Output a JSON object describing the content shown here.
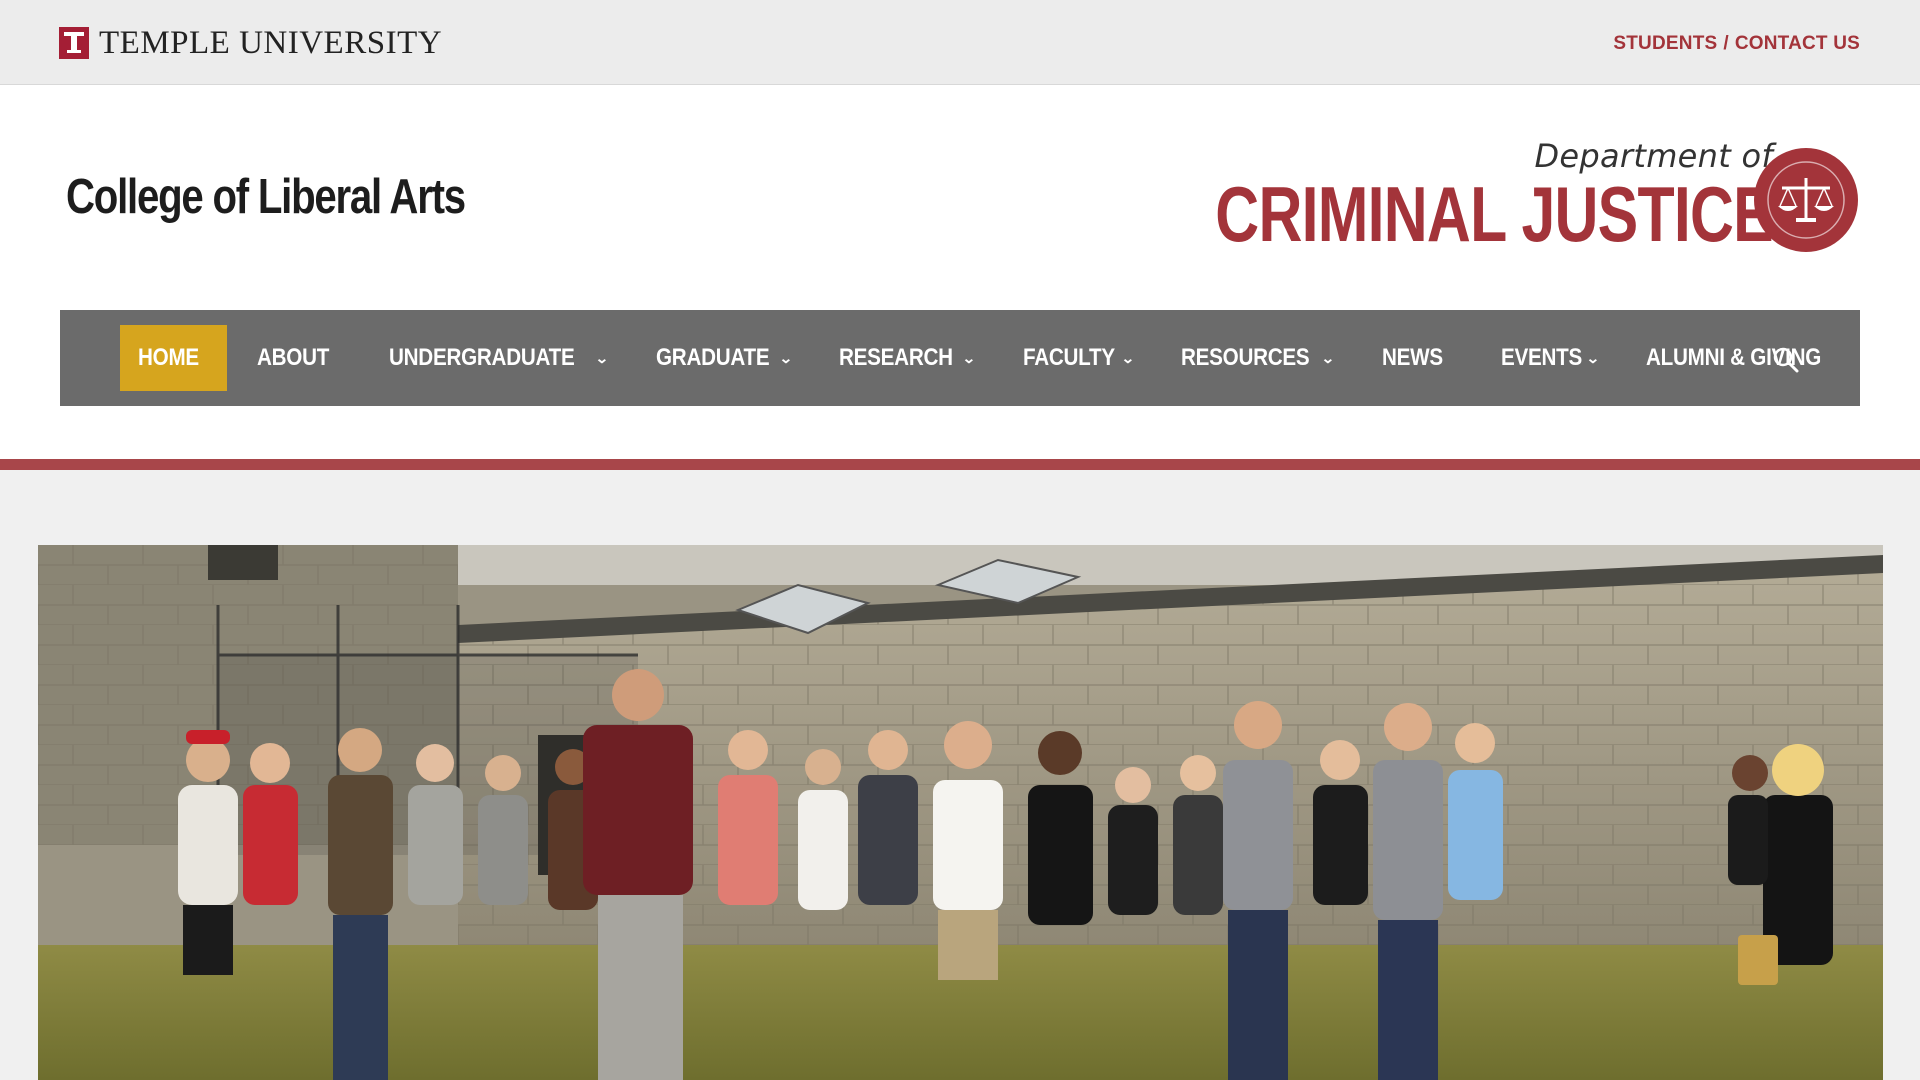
{
  "topbar": {
    "university_name": "TEMPLE UNIVERSITY",
    "util_link_1": "STUDENTS",
    "util_sep": "/",
    "util_link_2": "CONTACT US"
  },
  "header": {
    "college_name": "College of Liberal Arts",
    "dept_of": "Department of",
    "dept_name": "CRIMINAL JUSTICE",
    "seal_icon": "scales-of-justice-icon"
  },
  "nav": {
    "items": [
      {
        "label": "HOME",
        "active": true,
        "has_dropdown": false
      },
      {
        "label": "ABOUT",
        "active": false,
        "has_dropdown": false
      },
      {
        "label": "UNDERGRADUATE",
        "active": false,
        "has_dropdown": true
      },
      {
        "label": "GRADUATE",
        "active": false,
        "has_dropdown": true
      },
      {
        "label": "RESEARCH",
        "active": false,
        "has_dropdown": true
      },
      {
        "label": "FACULTY",
        "active": false,
        "has_dropdown": true
      },
      {
        "label": "RESOURCES",
        "active": false,
        "has_dropdown": true
      },
      {
        "label": "NEWS",
        "active": false,
        "has_dropdown": false
      },
      {
        "label": "EVENTS",
        "active": false,
        "has_dropdown": true
      },
      {
        "label": "ALUMNI & GIVING",
        "active": false,
        "has_dropdown": false
      }
    ],
    "search_icon": "search-icon"
  },
  "colors": {
    "brand_red": "#a3343a",
    "nav_bg": "#6b6b6b",
    "nav_active": "#d6a51e",
    "accent_line": "#a8464a"
  },
  "hero": {
    "image_subject": "photo"
  }
}
